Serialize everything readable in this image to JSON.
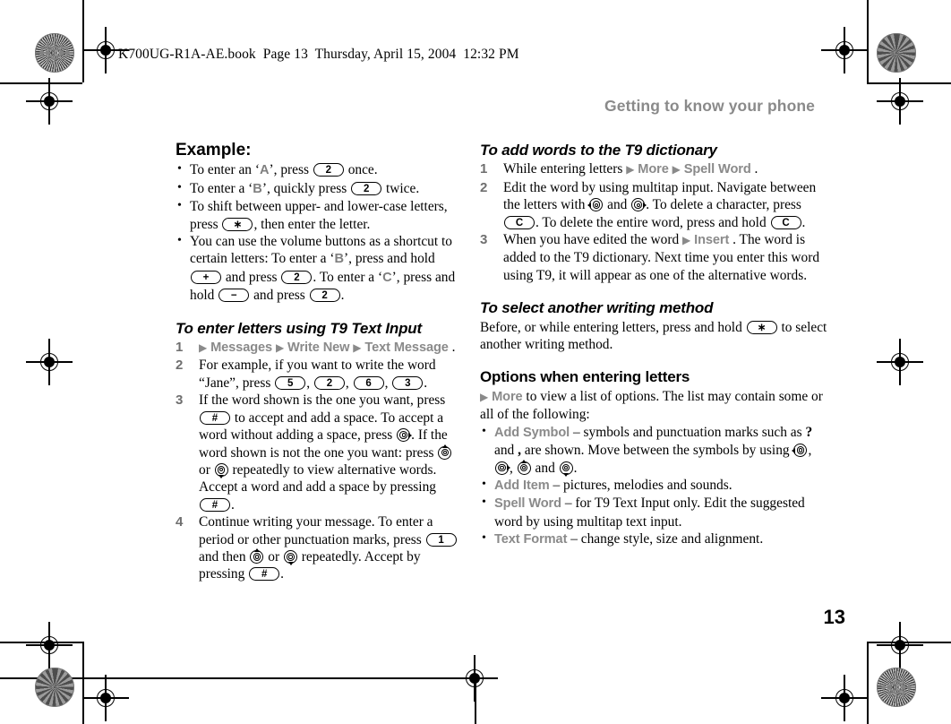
{
  "print": {
    "running_head": "K700UG-R1A-AE.book  Page 13  Thursday, April 15, 2004  12:32 PM"
  },
  "page": {
    "chapter_header": "Getting to know your phone",
    "folio": "13"
  },
  "left_column": {
    "example": {
      "heading": "Example:",
      "bullets": [
        {
          "parts": [
            {
              "t": "text",
              "v": "To enter an ‘"
            },
            {
              "t": "lcd",
              "v": "A"
            },
            {
              "t": "text",
              "v": "’, press "
            },
            {
              "t": "key",
              "v": "2"
            },
            {
              "t": "text",
              "v": " once."
            }
          ]
        },
        {
          "parts": [
            {
              "t": "text",
              "v": "To enter a ‘"
            },
            {
              "t": "lcd",
              "v": "B"
            },
            {
              "t": "text",
              "v": "’, quickly press "
            },
            {
              "t": "key",
              "v": "2"
            },
            {
              "t": "text",
              "v": " twice."
            }
          ]
        },
        {
          "parts": [
            {
              "t": "text",
              "v": "To shift between upper- and lower-case letters, press "
            },
            {
              "t": "key",
              "v": "∗"
            },
            {
              "t": "text",
              "v": ", then enter the letter."
            }
          ]
        },
        {
          "parts": [
            {
              "t": "text",
              "v": "You can use the volume buttons as a shortcut to certain letters: To enter a ‘"
            },
            {
              "t": "lcd",
              "v": "B"
            },
            {
              "t": "text",
              "v": "’, press and hold "
            },
            {
              "t": "key",
              "v": "+"
            },
            {
              "t": "text",
              "v": " and press "
            },
            {
              "t": "key",
              "v": "2"
            },
            {
              "t": "text",
              "v": ". To enter a ‘"
            },
            {
              "t": "lcd",
              "v": "C"
            },
            {
              "t": "text",
              "v": "’, press and hold "
            },
            {
              "t": "key",
              "v": "−"
            },
            {
              "t": "text",
              "v": " and press "
            },
            {
              "t": "key",
              "v": "2"
            },
            {
              "t": "text",
              "v": "."
            }
          ]
        }
      ]
    },
    "t9_input": {
      "heading": "To enter letters using T9 Text Input",
      "steps": [
        {
          "n": "1",
          "parts": [
            {
              "t": "arrow",
              "v": "▶"
            },
            {
              "t": "ui",
              "v": "Messages"
            },
            {
              "t": "arrow",
              "v": "▶"
            },
            {
              "t": "ui",
              "v": "Write New"
            },
            {
              "t": "arrow",
              "v": "▶"
            },
            {
              "t": "ui",
              "v": "Text Message"
            },
            {
              "t": "text",
              "v": "."
            }
          ]
        },
        {
          "n": "2",
          "parts": [
            {
              "t": "text",
              "v": "For example, if you want to write the word “Jane”, press "
            },
            {
              "t": "key",
              "v": "5"
            },
            {
              "t": "text",
              "v": ", "
            },
            {
              "t": "key",
              "v": "2"
            },
            {
              "t": "text",
              "v": ", "
            },
            {
              "t": "key",
              "v": "6"
            },
            {
              "t": "text",
              "v": ", "
            },
            {
              "t": "key",
              "v": "3"
            },
            {
              "t": "text",
              "v": "."
            }
          ]
        },
        {
          "n": "3",
          "parts": [
            {
              "t": "text",
              "v": "If the word shown is the one you want, press "
            },
            {
              "t": "key",
              "v": "#"
            },
            {
              "t": "text",
              "v": " to accept and add a space. To accept a word without adding a space, press "
            },
            {
              "t": "nav",
              "v": "right"
            },
            {
              "t": "text",
              "v": ". If the word shown is not the one you want: press "
            },
            {
              "t": "nav",
              "v": "up"
            },
            {
              "t": "text",
              "v": " or "
            },
            {
              "t": "nav",
              "v": "down"
            },
            {
              "t": "text",
              "v": " repeatedly to view alternative words. Accept a word and add a space by pressing "
            },
            {
              "t": "key",
              "v": "#"
            },
            {
              "t": "text",
              "v": "."
            }
          ]
        },
        {
          "n": "4",
          "parts": [
            {
              "t": "text",
              "v": "Continue writing your message. To enter a period or other punctuation marks, press "
            },
            {
              "t": "key",
              "v": "1"
            },
            {
              "t": "text",
              "v": " and then "
            },
            {
              "t": "nav",
              "v": "up"
            },
            {
              "t": "text",
              "v": " or "
            },
            {
              "t": "nav",
              "v": "down"
            },
            {
              "t": "text",
              "v": " repeatedly. Accept by pressing "
            },
            {
              "t": "key",
              "v": "#"
            },
            {
              "t": "text",
              "v": "."
            }
          ]
        }
      ]
    }
  },
  "right_column": {
    "add_words": {
      "heading": "To add words to the T9 dictionary",
      "steps": [
        {
          "n": "1",
          "parts": [
            {
              "t": "text",
              "v": "While entering letters "
            },
            {
              "t": "arrow",
              "v": "▶"
            },
            {
              "t": "ui",
              "v": "More"
            },
            {
              "t": "arrow",
              "v": "▶"
            },
            {
              "t": "ui",
              "v": "Spell Word"
            },
            {
              "t": "text",
              "v": "."
            }
          ]
        },
        {
          "n": "2",
          "parts": [
            {
              "t": "text",
              "v": "Edit the word by using multitap input. Navigate between the letters with "
            },
            {
              "t": "nav",
              "v": "left"
            },
            {
              "t": "text",
              "v": " and "
            },
            {
              "t": "nav",
              "v": "right"
            },
            {
              "t": "text",
              "v": ". To delete a character, press "
            },
            {
              "t": "key",
              "v": "C"
            },
            {
              "t": "text",
              "v": ". To delete the entire word, press and hold "
            },
            {
              "t": "key",
              "v": "C"
            },
            {
              "t": "text",
              "v": "."
            }
          ]
        },
        {
          "n": "3",
          "parts": [
            {
              "t": "text",
              "v": "When you have edited the word "
            },
            {
              "t": "arrow",
              "v": "▶"
            },
            {
              "t": "ui",
              "v": "Insert"
            },
            {
              "t": "text",
              "v": ". The word is added to the T9 dictionary. Next time you enter this word using T9, it will appear as one of the alternative words."
            }
          ]
        }
      ]
    },
    "select_method": {
      "heading": "To select another writing method",
      "parts": [
        {
          "t": "text",
          "v": "Before, or while entering letters, press and hold "
        },
        {
          "t": "key",
          "v": "∗"
        },
        {
          "t": "text",
          "v": " to select another writing method."
        }
      ]
    },
    "options": {
      "heading": "Options when entering letters",
      "intro_parts": [
        {
          "t": "arrow",
          "v": "▶"
        },
        {
          "t": "ui",
          "v": "More"
        },
        {
          "t": "text",
          "v": " to view a list of options. The list may contain some or all of the following:"
        }
      ],
      "bullets": [
        {
          "parts": [
            {
              "t": "ui",
              "v": "Add Symbol"
            },
            {
              "t": "text",
              "v": " – symbols and punctuation marks such as "
            },
            {
              "t": "sym",
              "v": "?"
            },
            {
              "t": "text",
              "v": " and "
            },
            {
              "t": "sym",
              "v": ","
            },
            {
              "t": "text",
              "v": " are shown. Move between the symbols by using "
            },
            {
              "t": "nav",
              "v": "left"
            },
            {
              "t": "text",
              "v": ", "
            },
            {
              "t": "nav",
              "v": "right"
            },
            {
              "t": "text",
              "v": ", "
            },
            {
              "t": "nav",
              "v": "up"
            },
            {
              "t": "text",
              "v": " and "
            },
            {
              "t": "nav",
              "v": "down"
            },
            {
              "t": "text",
              "v": "."
            }
          ]
        },
        {
          "parts": [
            {
              "t": "ui",
              "v": "Add Item"
            },
            {
              "t": "text",
              "v": " – pictures, melodies and sounds."
            }
          ]
        },
        {
          "parts": [
            {
              "t": "ui",
              "v": "Spell Word"
            },
            {
              "t": "text",
              "v": " – for T9 Text Input only. Edit the suggested word by using multitap text input."
            }
          ]
        },
        {
          "parts": [
            {
              "t": "ui",
              "v": "Text Format"
            },
            {
              "t": "text",
              "v": " – change style, size and alignment."
            }
          ]
        }
      ]
    }
  },
  "colors": {
    "ui_gray": "#8a8a8a",
    "header_gray": "#8a8a8a",
    "text_black": "#000000"
  }
}
